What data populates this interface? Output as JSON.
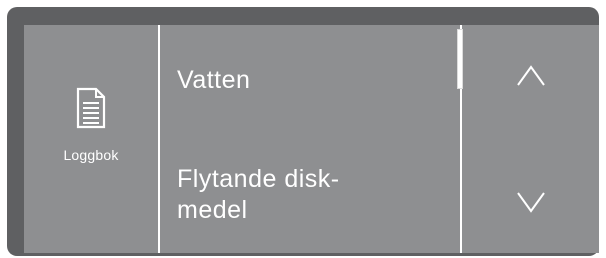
{
  "sidebar": {
    "icon": "logbook-document-icon",
    "label": "Loggbok"
  },
  "menu": {
    "items": [
      {
        "label": "Vatten"
      },
      {
        "label_lines": [
          "Flytande disk-",
          "medel"
        ]
      }
    ]
  },
  "scrollbar": {
    "position_fraction": 0.0,
    "visible_fraction": 0.27
  },
  "navigation": {
    "up_icon": "chevron-up-icon",
    "down_icon": "chevron-down-icon"
  },
  "colors": {
    "screen_background": "#8e8f91",
    "bezel": "#5f6062",
    "foreground": "#ffffff"
  }
}
